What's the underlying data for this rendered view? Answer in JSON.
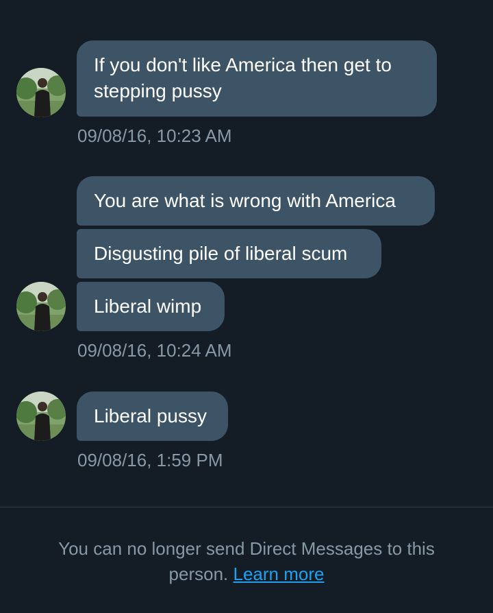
{
  "messages": [
    {
      "bubbles": [
        "If you don't like America then get to",
        "stepping pussy"
      ],
      "timestamp": "09/08/16, 10:23 AM"
    },
    {
      "bubbles": [
        "You are what is wrong with America",
        "Disgusting pile of liberal scum",
        "Liberal wimp"
      ],
      "timestamp": "09/08/16, 10:24 AM"
    },
    {
      "bubbles": [
        "Liberal pussy"
      ],
      "timestamp": "09/08/16, 1:59 PM"
    }
  ],
  "footer": {
    "notice": "You can no longer send Direct Messages to this person.",
    "link_label": "Learn more"
  },
  "colors": {
    "background": "#141d26",
    "bubble": "#3d5466",
    "muted_text": "#8899a6",
    "link": "#1da1f2"
  },
  "icons": {
    "avatar": "user-avatar-photo"
  }
}
